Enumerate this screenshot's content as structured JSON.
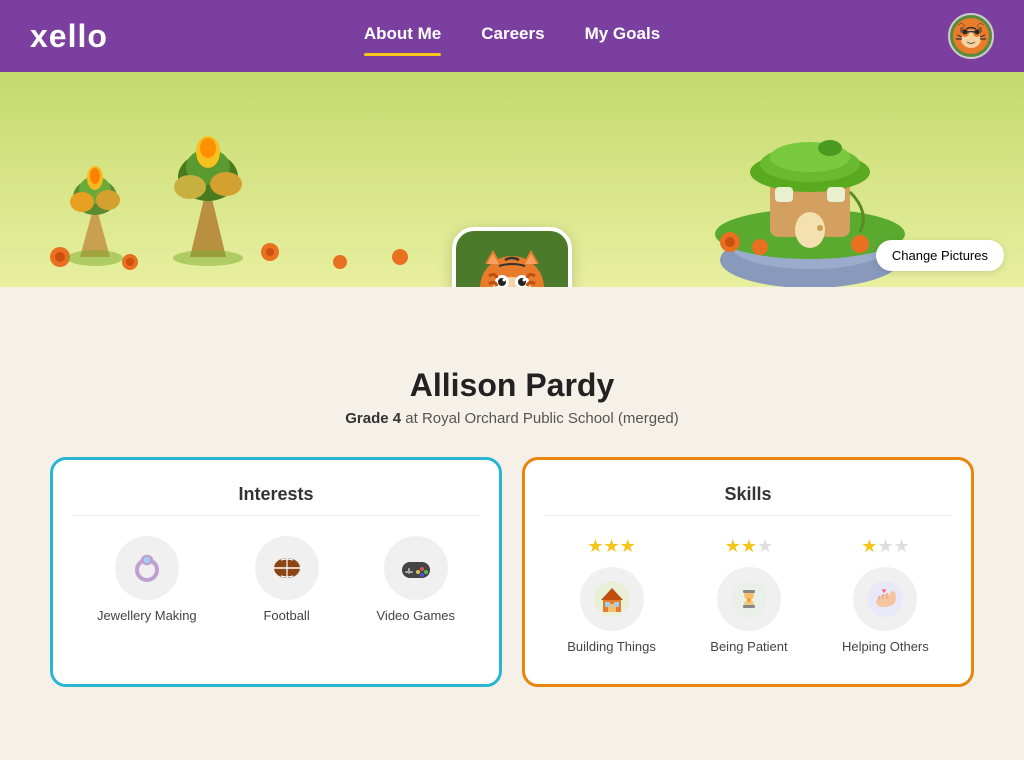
{
  "navbar": {
    "logo": "xello",
    "links": [
      {
        "label": "About Me",
        "active": true
      },
      {
        "label": "Careers",
        "active": false
      },
      {
        "label": "My Goals",
        "active": false
      }
    ],
    "avatar_emoji": "🐯"
  },
  "banner": {
    "change_pictures_label": "Change Pictures"
  },
  "profile": {
    "name": "Allison Pardy",
    "grade_label": "Grade 4",
    "school": "at Royal Orchard Public School (merged)"
  },
  "interests_card": {
    "title": "Interests",
    "items": [
      {
        "label": "Jewellery Making",
        "emoji": "💍"
      },
      {
        "label": "Football",
        "emoji": "🏈"
      },
      {
        "label": "Video Games",
        "emoji": "🎮"
      }
    ]
  },
  "skills_card": {
    "title": "Skills",
    "items": [
      {
        "label": "Building Things",
        "emoji": "🏠",
        "stars": 3,
        "total": 3
      },
      {
        "label": "Being Patient",
        "emoji": "⏳",
        "stars": 2,
        "total": 3
      },
      {
        "label": "Helping Others",
        "emoji": "🤝",
        "stars": 1,
        "total": 3
      }
    ]
  }
}
